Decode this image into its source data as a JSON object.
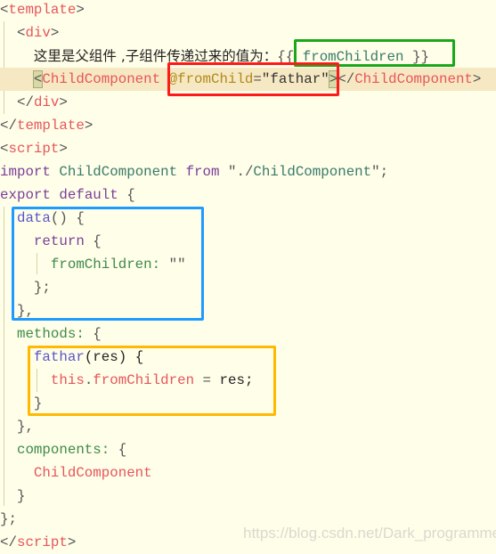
{
  "code_lines": [
    {
      "tokens": [
        [
          "<",
          "p"
        ],
        [
          "template",
          "tag"
        ],
        [
          ">",
          "p"
        ]
      ]
    },
    {
      "tokens": [
        [
          "  ",
          ""
        ],
        [
          "<",
          "p"
        ],
        [
          "div",
          "tag"
        ],
        [
          ">",
          "p"
        ]
      ]
    },
    {
      "tokens": [
        [
          "    ",
          ""
        ],
        [
          "这里是父组件 ,子组件传递过来的值为：",
          "cn"
        ],
        [
          "{{ ",
          "p"
        ],
        [
          "fromChildren",
          "id"
        ],
        [
          " }}",
          "p"
        ]
      ]
    },
    {
      "highlight": true,
      "tokens": [
        [
          "    ",
          ""
        ],
        [
          "<",
          "p match"
        ],
        [
          "ChildComponent",
          "tag"
        ],
        [
          " ",
          ""
        ],
        [
          "@fromChild",
          "attr"
        ],
        [
          "=",
          "p"
        ],
        [
          "\"fathar\"",
          "str"
        ],
        [
          ">",
          "p match"
        ],
        [
          "</",
          "p"
        ],
        [
          "ChildComponent",
          "tag"
        ],
        [
          ">",
          "p"
        ]
      ]
    },
    {
      "tokens": [
        [
          "  ",
          ""
        ],
        [
          "</",
          "p"
        ],
        [
          "div",
          "tag"
        ],
        [
          ">",
          "p"
        ]
      ]
    },
    {
      "tokens": [
        [
          "</",
          "p"
        ],
        [
          "template",
          "tag"
        ],
        [
          ">",
          "p"
        ]
      ]
    },
    {
      "tokens": [
        [
          "<",
          "p"
        ],
        [
          "script",
          "tag"
        ],
        [
          ">",
          "p"
        ]
      ]
    },
    {
      "tokens": [
        [
          "import",
          "kw"
        ],
        [
          " ",
          ""
        ],
        [
          "ChildComponent",
          "id"
        ],
        [
          " ",
          ""
        ],
        [
          "from",
          "kw"
        ],
        [
          " \"./",
          "p"
        ],
        [
          "ChildComponent",
          "id"
        ],
        [
          "\";",
          "p"
        ]
      ]
    },
    {
      "tokens": [
        [
          "export",
          "kw"
        ],
        [
          " ",
          ""
        ],
        [
          "default",
          "kw"
        ],
        [
          " {",
          "p"
        ]
      ]
    },
    {
      "tokens": [
        [
          "  ",
          ""
        ],
        [
          "data",
          "fn"
        ],
        [
          "() {",
          "p"
        ]
      ]
    },
    {
      "tokens": [
        [
          "    ",
          ""
        ],
        [
          "return",
          "kw"
        ],
        [
          " {",
          "p"
        ]
      ]
    },
    {
      "tokens": [
        [
          "      ",
          ""
        ],
        [
          "fromChildren:",
          "prop"
        ],
        [
          " \"\"",
          "p"
        ]
      ]
    },
    {
      "tokens": [
        [
          "    ",
          ""
        ],
        [
          "};",
          "p"
        ]
      ]
    },
    {
      "tokens": [
        [
          "  ",
          ""
        ],
        [
          "},",
          "p"
        ]
      ]
    },
    {
      "tokens": [
        [
          "  ",
          ""
        ],
        [
          "methods:",
          "prop"
        ],
        [
          " {",
          "p"
        ]
      ]
    },
    {
      "tokens": [
        [
          "    ",
          ""
        ],
        [
          "fathar",
          "fn"
        ],
        [
          "(res) {",
          "plain"
        ]
      ]
    },
    {
      "tokens": [
        [
          "      ",
          ""
        ],
        [
          "this",
          "red"
        ],
        [
          ".",
          "p"
        ],
        [
          "fromChildren",
          "red"
        ],
        [
          " = ",
          "p"
        ],
        [
          "res;",
          "plain"
        ]
      ]
    },
    {
      "tokens": [
        [
          "    ",
          ""
        ],
        [
          "}",
          "p"
        ]
      ]
    },
    {
      "tokens": [
        [
          "  ",
          ""
        ],
        [
          "},",
          "p"
        ]
      ]
    },
    {
      "tokens": [
        [
          "  ",
          ""
        ],
        [
          "components:",
          "prop"
        ],
        [
          " {",
          "p"
        ]
      ]
    },
    {
      "tokens": [
        [
          "    ",
          ""
        ],
        [
          "ChildComponent",
          "red"
        ]
      ]
    },
    {
      "tokens": [
        [
          "  ",
          ""
        ],
        [
          "}",
          "p"
        ]
      ]
    },
    {
      "tokens": [
        [
          "};",
          "p"
        ]
      ]
    },
    {
      "tokens": [
        [
          "</",
          "p"
        ],
        [
          "script",
          "tag"
        ],
        [
          ">",
          "p"
        ]
      ]
    }
  ],
  "annotations": {
    "green": "#1aa81a",
    "red": "#ff1a1a",
    "blue": "#1e9bff",
    "orange": "#ffb900"
  },
  "watermark": "https://blog.csdn.net/Dark_programmer"
}
